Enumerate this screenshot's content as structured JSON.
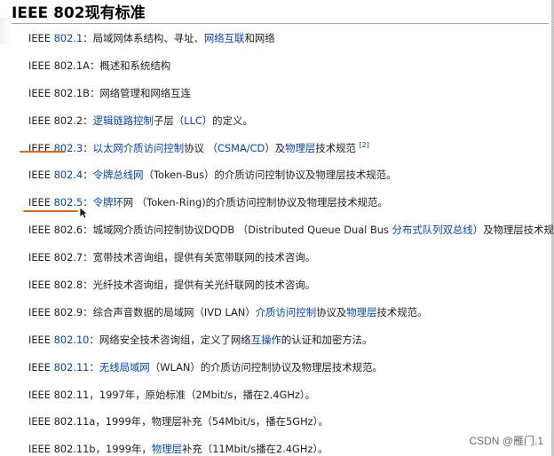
{
  "heading": "IEEE 802现有标准",
  "items": [
    {
      "segments": [
        {
          "t": "IEEE "
        },
        {
          "t": "802.1",
          "link": true
        },
        {
          "t": "：局域网体系结构、寻址、"
        },
        {
          "t": "网络互联",
          "link": true
        },
        {
          "t": "和网络"
        }
      ]
    },
    {
      "segments": [
        {
          "t": "IEEE 802.1A：概述和系统结构"
        }
      ]
    },
    {
      "segments": [
        {
          "t": "IEEE 802.1B：网络管理和网络互连"
        }
      ]
    },
    {
      "segments": [
        {
          "t": "IEEE 802.2："
        },
        {
          "t": "逻辑链路控制",
          "link": true
        },
        {
          "t": "子层（"
        },
        {
          "t": "LLC",
          "link": true
        },
        {
          "t": "）的定义。"
        }
      ]
    },
    {
      "segments": [
        {
          "t": "IEEE "
        },
        {
          "t": "802.3",
          "link": true
        },
        {
          "t": "："
        },
        {
          "t": "以太网",
          "link": true
        },
        {
          "t": "介质访问控制",
          "link": true
        },
        {
          "t": "协议 （"
        },
        {
          "t": "CSMA/CD",
          "link": true
        },
        {
          "t": "）及"
        },
        {
          "t": "物理层",
          "link": true
        },
        {
          "t": "技术规范 "
        },
        {
          "t": "[2]",
          "sup": true
        }
      ]
    },
    {
      "segments": [
        {
          "t": "IEEE "
        },
        {
          "t": "802.4",
          "link": true
        },
        {
          "t": "："
        },
        {
          "t": "令牌总线网",
          "link": true
        },
        {
          "t": "（Token-Bus）的介质访问控制协议及物理层技术规范。"
        }
      ]
    },
    {
      "segments": [
        {
          "t": "IEEE "
        },
        {
          "t": "802.5",
          "link": true
        },
        {
          "t": "："
        },
        {
          "t": "令牌环",
          "link": true
        },
        {
          "t": "网 （Token-Ring)的介质访问控制协议及物理层技术规范。"
        }
      ]
    },
    {
      "segments": [
        {
          "t": "IEEE 802.6：城域网介质访问控制协议DQDB （Distributed Queue Dual Bus "
        },
        {
          "t": "分布式队列双总线",
          "link": true
        },
        {
          "t": "）及物理层技术规范。"
        }
      ]
    },
    {
      "segments": [
        {
          "t": "IEEE 802.7：宽带技术咨询组，提供有关宽带联网的技术咨询。"
        }
      ]
    },
    {
      "segments": [
        {
          "t": "IEEE 802.8：光纤技术咨询组，提供有关光纤联网的技术咨询。"
        }
      ]
    },
    {
      "segments": [
        {
          "t": "IEEE 802.9：综合声音数据的局域网（IVD LAN）"
        },
        {
          "t": "介质访问控制",
          "link": true
        },
        {
          "t": "协议及"
        },
        {
          "t": "物理层",
          "link": true
        },
        {
          "t": "技术规范。"
        }
      ]
    },
    {
      "segments": [
        {
          "t": "IEEE "
        },
        {
          "t": "802.10",
          "link": true
        },
        {
          "t": "：网络安全技术咨询组，定义了网络"
        },
        {
          "t": "互操作",
          "link": true
        },
        {
          "t": "的认证和加密方法。"
        }
      ]
    },
    {
      "segments": [
        {
          "t": "IEEE "
        },
        {
          "t": "802.11",
          "link": true
        },
        {
          "t": "："
        },
        {
          "t": "无线局域网",
          "link": true
        },
        {
          "t": "（WLAN）的介质访问控制协议及物理层技术规范。"
        }
      ]
    },
    {
      "segments": [
        {
          "t": "IEEE 802.11，1997年，原始标准（2Mbit/s，播在2.4GHz）。"
        }
      ]
    },
    {
      "segments": [
        {
          "t": "IEEE 802.11a，1999年，物理层补充（54Mbit/s，播在5GHz）。"
        }
      ]
    },
    {
      "segments": [
        {
          "t": "IEEE 802.11b，1999年，"
        },
        {
          "t": "物理层",
          "link": true
        },
        {
          "t": "补充（11Mbit/s播在2.4GHz）。"
        }
      ]
    }
  ],
  "watermark": "CSDN @雁门.1",
  "colors": {
    "link": "#0645ad",
    "annotation": "#d2691e",
    "text": "#222222"
  }
}
